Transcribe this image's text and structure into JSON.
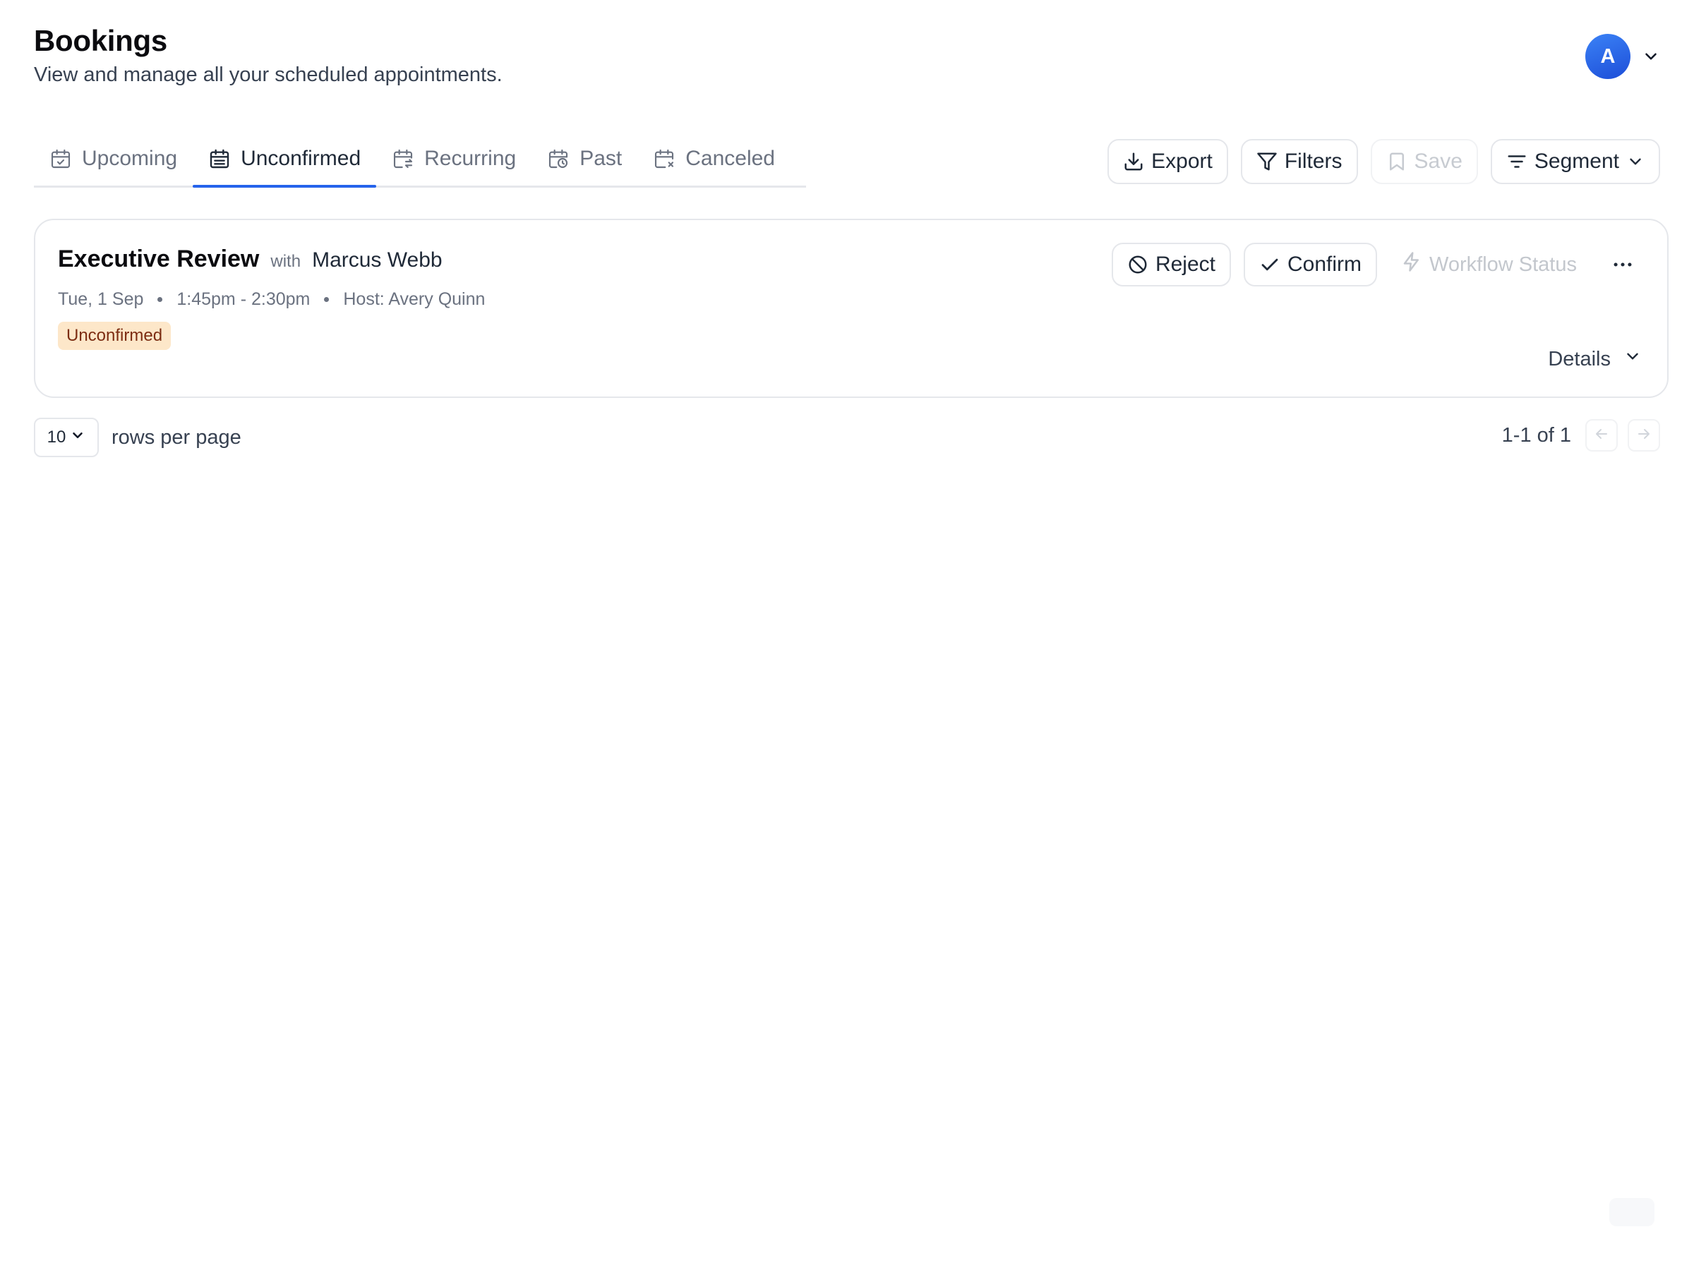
{
  "header": {
    "title": "Bookings",
    "subtitle": "View and manage all your scheduled appointments.",
    "avatar_initial": "A"
  },
  "tabs": [
    {
      "label": "Upcoming",
      "icon": "calendar-check-icon",
      "active": false
    },
    {
      "label": "Unconfirmed",
      "icon": "calendar-list-icon",
      "active": true
    },
    {
      "label": "Recurring",
      "icon": "calendar-repeat-icon",
      "active": false
    },
    {
      "label": "Past",
      "icon": "calendar-clock-icon",
      "active": false
    },
    {
      "label": "Canceled",
      "icon": "calendar-x-icon",
      "active": false
    }
  ],
  "toolbar": {
    "export_label": "Export",
    "filters_label": "Filters",
    "save_label": "Save",
    "segment_label": "Segment"
  },
  "booking": {
    "title": "Executive Review",
    "with_label": "with",
    "attendee": "Marcus Webb",
    "date": "Tue, 1 Sep",
    "time": "1:45pm - 2:30pm",
    "host": "Host: Avery Quinn",
    "status": "Unconfirmed",
    "reject_label": "Reject",
    "confirm_label": "Confirm",
    "workflow_label": "Workflow Status",
    "details_label": "Details"
  },
  "pagination": {
    "rows_per_page_value": "10",
    "rows_per_page_label": "rows per page",
    "range": "1-1 of 1"
  },
  "colors": {
    "accent": "#2563eb",
    "badge_bg": "#fde7c9",
    "badge_text": "#7c2d12"
  }
}
